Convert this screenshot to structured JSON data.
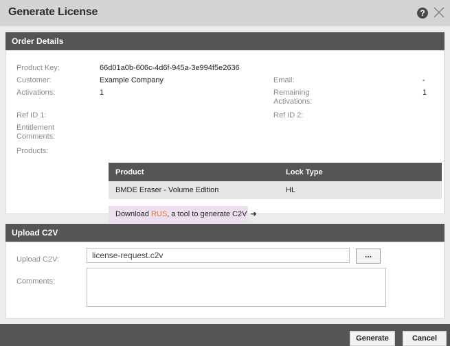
{
  "dialog": {
    "title": "Generate License",
    "help_icon": "?",
    "close_icon": "close-icon"
  },
  "order_details": {
    "header": "Order Details",
    "product_key_label": "Product Key:",
    "product_key": "66d01a0b-606c-4d6f-945a-3e994f5e2636",
    "customer_label": "Customer:",
    "customer": "Example Company",
    "email_label": "Email:",
    "email": "-",
    "activations_label": "Activations:",
    "activations": "1",
    "remaining_label_1": "Remaining",
    "remaining_label_2": "Activations:",
    "remaining": "1",
    "ref1_label": "Ref ID 1:",
    "ref2_label": "Ref ID 2:",
    "entitlement_label_1": "Entitlement",
    "entitlement_label_2": "Comments:",
    "products_label": "Products:",
    "products_table": {
      "headers": [
        "Product",
        "Lock Type"
      ],
      "rows": [
        {
          "product": "BMDE Eraser - Volume Edition",
          "lock_type": "HL"
        }
      ]
    },
    "download": {
      "prefix": "Download ",
      "link": "RUS",
      "suffix": ", a tool to generate C2V",
      "arrow": "➜"
    }
  },
  "upload": {
    "header": "Upload C2V",
    "file_label": "Upload C2V:",
    "file_value": "license-request.c2v",
    "browse_label": "...",
    "comments_label": "Comments:",
    "comments_value": ""
  },
  "footer": {
    "generate_label": "Generate",
    "cancel_label": "Cancel"
  }
}
